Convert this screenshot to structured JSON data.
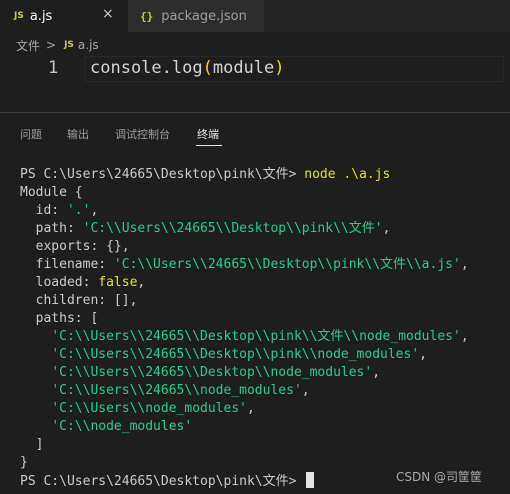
{
  "tabs": {
    "active": {
      "icon_label": "JS",
      "label": "a.js",
      "close": "×"
    },
    "inactive": {
      "icon_label": "{}",
      "label": "package.json"
    }
  },
  "breadcrumb": {
    "folder": "文件",
    "separator": ">",
    "icon_label": "JS",
    "file": "a.js"
  },
  "editor": {
    "line_number": "1",
    "code_prefix": "console.log",
    "open_paren": "(",
    "code_arg": "module",
    "close_paren": ")"
  },
  "panel": {
    "tabs": [
      {
        "label": "问题"
      },
      {
        "label": "输出"
      },
      {
        "label": "调试控制台"
      },
      {
        "label": "终端"
      }
    ],
    "active_tab": "终端"
  },
  "terminal": {
    "prompt": "PS C:\\Users\\24665\\Desktop\\pink\\文件> ",
    "command": "node .\\a.js",
    "lines": {
      "l1": "Module {",
      "id_key": "  id: ",
      "id_val": "'.'",
      "id_end": ",",
      "path_key": "  path: ",
      "path_val": "'C:\\\\Users\\\\24665\\\\Desktop\\\\pink\\\\文件'",
      "path_end": ",",
      "exports": "  exports: {},",
      "filename_key": "  filename: ",
      "filename_val": "'C:\\\\Users\\\\24665\\\\Desktop\\\\pink\\\\文件\\\\a.js'",
      "filename_end": ",",
      "loaded_key": "  loaded: ",
      "loaded_val": "false",
      "loaded_end": ",",
      "children": "  children: [],",
      "paths_key": "  paths: [",
      "p1": "'C:\\\\Users\\\\24665\\\\Desktop\\\\pink\\\\文件\\\\node_modules'",
      "p2": "'C:\\\\Users\\\\24665\\\\Desktop\\\\pink\\\\node_modules'",
      "p3": "'C:\\\\Users\\\\24665\\\\Desktop\\\\node_modules'",
      "p4": "'C:\\\\Users\\\\24665\\\\node_modules'",
      "p5": "'C:\\\\Users\\\\node_modules'",
      "p6": "'C:\\\\node_modules'",
      "comma": ",",
      "indent_p": "    ",
      "close_bracket": "  ]",
      "close_brace": "}"
    },
    "final_prompt": "PS C:\\Users\\24665\\Desktop\\pink\\文件> "
  },
  "watermark": "CSDN @司筐筐"
}
